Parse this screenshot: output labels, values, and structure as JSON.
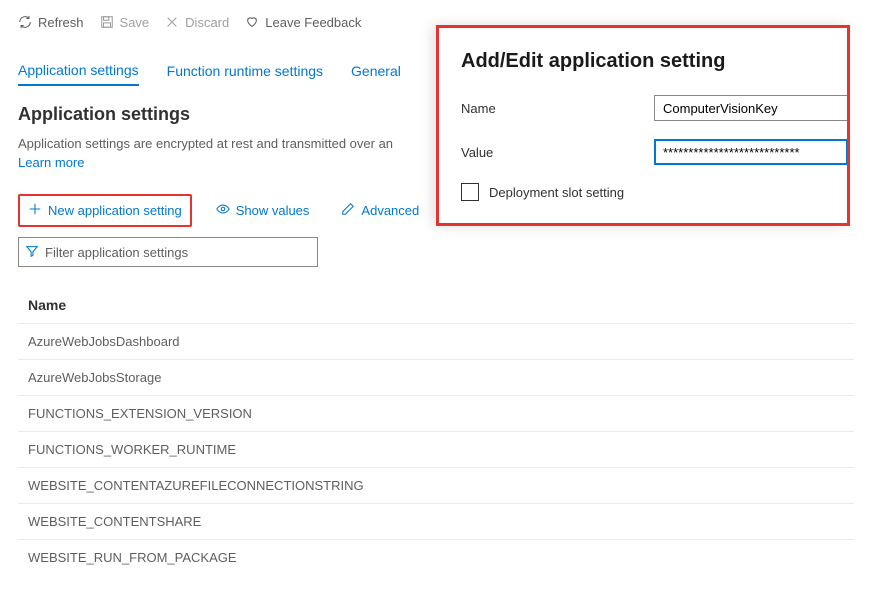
{
  "toolbar": {
    "refresh": "Refresh",
    "save": "Save",
    "discard": "Discard",
    "feedback": "Leave Feedback"
  },
  "tabs": [
    {
      "label": "Application settings",
      "active": true
    },
    {
      "label": "Function runtime settings",
      "active": false
    },
    {
      "label": "General",
      "active": false
    }
  ],
  "section": {
    "title": "Application settings",
    "desc": "Application settings are encrypted at rest and transmitted over an",
    "learn_more": "Learn more"
  },
  "actions": {
    "new_setting": "New application setting",
    "show_values": "Show values",
    "advanced": "Advanced"
  },
  "filter": {
    "placeholder": "Filter application settings"
  },
  "table": {
    "header": "Name",
    "rows": [
      "AzureWebJobsDashboard",
      "AzureWebJobsStorage",
      "FUNCTIONS_EXTENSION_VERSION",
      "FUNCTIONS_WORKER_RUNTIME",
      "WEBSITE_CONTENTAZUREFILECONNECTIONSTRING",
      "WEBSITE_CONTENTSHARE",
      "WEBSITE_RUN_FROM_PACKAGE"
    ]
  },
  "panel": {
    "title": "Add/Edit application setting",
    "name_label": "Name",
    "name_value": "ComputerVisionKey",
    "value_label": "Value",
    "value_value": "***************************",
    "slot_label": "Deployment slot setting"
  }
}
